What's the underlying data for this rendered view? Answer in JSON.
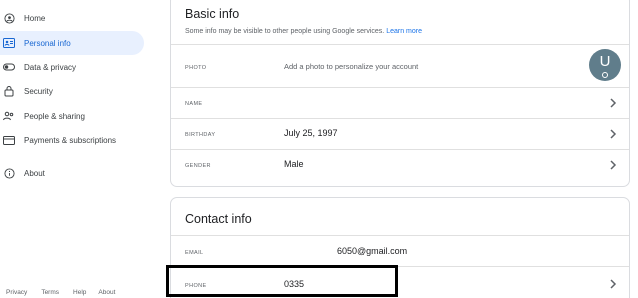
{
  "sidebar": {
    "items": [
      {
        "label": "Home",
        "icon": "home-icon"
      },
      {
        "label": "Personal info",
        "icon": "personal-info-icon",
        "active": true
      },
      {
        "label": "Data & privacy",
        "icon": "toggle-icon"
      },
      {
        "label": "Security",
        "icon": "lock-icon"
      },
      {
        "label": "People & sharing",
        "icon": "people-icon"
      },
      {
        "label": "Payments & subscriptions",
        "icon": "credit-card-icon"
      },
      {
        "label": "About",
        "icon": "info-icon"
      }
    ],
    "footer": [
      "Privacy",
      "Terms",
      "Help",
      "About"
    ]
  },
  "basic_info": {
    "title": "Basic info",
    "subtitle": "Some info may be visible to other people using Google services.",
    "learn_more": "Learn more",
    "photo": {
      "label": "PHOTO",
      "hint": "Add a photo to personalize your account",
      "avatar_letter": "U"
    },
    "name": {
      "label": "NAME",
      "value": ""
    },
    "birthday": {
      "label": "BIRTHDAY",
      "value": "July 25, 1997"
    },
    "gender": {
      "label": "GENDER",
      "value": "Male"
    }
  },
  "contact_info": {
    "title": "Contact info",
    "email": {
      "label": "EMAIL",
      "value": "6050@gmail.com"
    },
    "phone": {
      "label": "PHONE",
      "value": "0335"
    }
  },
  "colors": {
    "accent": "#1a73e8",
    "active_bg": "#e8f0fe",
    "active_text": "#1967d2"
  }
}
